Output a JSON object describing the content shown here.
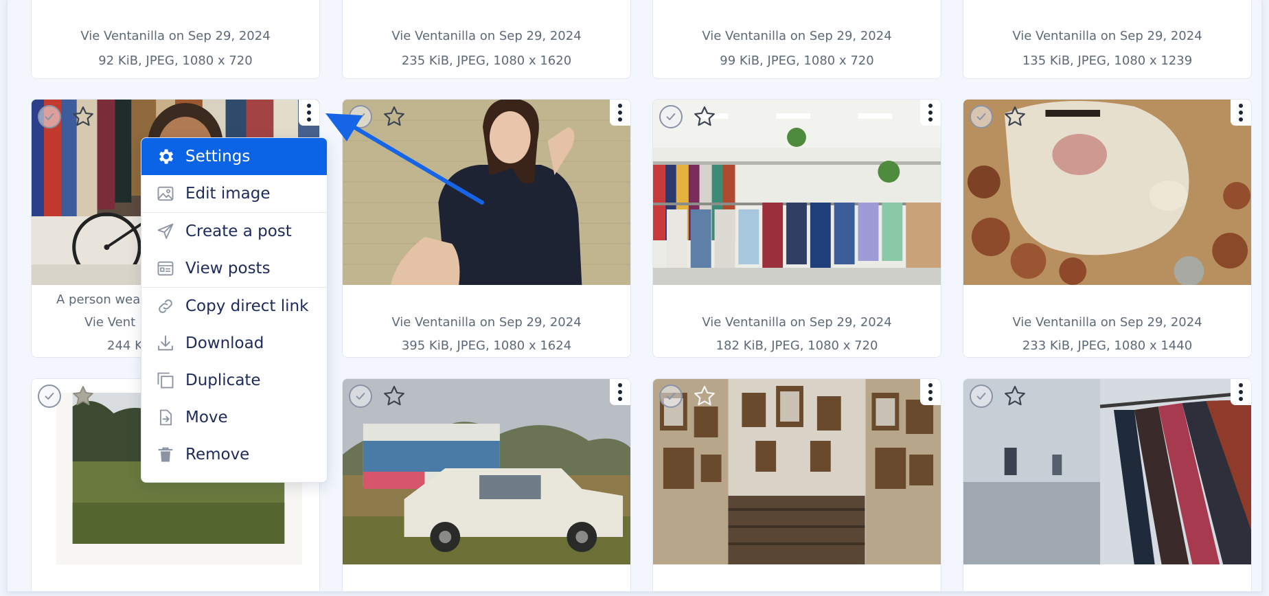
{
  "gallery": {
    "row1": [
      {
        "author": "Vie Ventanilla on Sep 29, 2024",
        "info": "92 KiB, JPEG, 1080 x 720"
      },
      {
        "author": "Vie Ventanilla on Sep 29, 2024",
        "info": "235 KiB, JPEG, 1080 x 1620"
      },
      {
        "author": "Vie Ventanilla on Sep 29, 2024",
        "info": "99 KiB, JPEG, 1080 x 720"
      },
      {
        "author": "Vie Ventanilla on Sep 29, 2024",
        "info": "135 KiB, JPEG, 1080 x 1239"
      }
    ],
    "row2": [
      {
        "caption": "A person wea",
        "author": "Vie Vent",
        "info": "244 K"
      },
      {
        "author": "Vie Ventanilla on Sep 29, 2024",
        "info": "395 KiB, JPEG, 1080 x 1624"
      },
      {
        "author": "Vie Ventanilla on Sep 29, 2024",
        "info": "182 KiB, JPEG, 1080 x 720"
      },
      {
        "author": "Vie Ventanilla on Sep 29, 2024",
        "info": "233 KiB, JPEG, 1080 x 1440"
      }
    ],
    "row3_photos": [
      "polaroid-field",
      "thrift-shop-truck",
      "mirror-staircase",
      "clothing-rack"
    ]
  },
  "context_menu": {
    "items": [
      {
        "label": "Settings",
        "icon": "gear-icon",
        "active": true
      },
      {
        "label": "Edit image",
        "icon": "image-edit-icon"
      },
      {
        "label": "Create a post",
        "icon": "paper-plane-icon"
      },
      {
        "label": "View posts",
        "icon": "posts-list-icon"
      },
      {
        "label": "Copy direct link",
        "icon": "link-icon"
      },
      {
        "label": "Download",
        "icon": "download-icon"
      },
      {
        "label": "Duplicate",
        "icon": "duplicate-icon"
      },
      {
        "label": "Move",
        "icon": "move-icon"
      },
      {
        "label": "Remove",
        "icon": "trash-icon"
      }
    ]
  },
  "colors": {
    "accent": "#0b63e5",
    "annotation_arrow": "#1565e6",
    "menu_text": "#1d2a5a",
    "meta_text": "#5e6978"
  }
}
